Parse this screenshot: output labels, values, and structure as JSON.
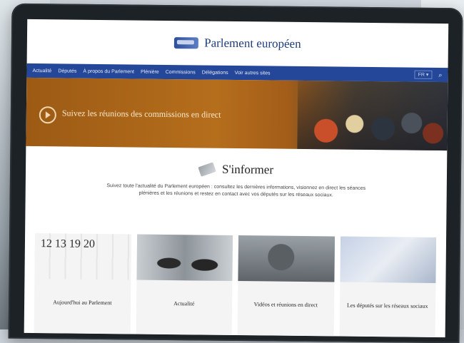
{
  "site": {
    "title": "Parlement européen"
  },
  "nav": {
    "items": [
      "Actualité",
      "Députés",
      "À propos du Parlement",
      "Plénière",
      "Commissions",
      "Délégations",
      "Voir autres sites"
    ],
    "lang": "FR ▾"
  },
  "banner": {
    "text": "Suivez les réunions des commissions en direct"
  },
  "section": {
    "title": "S'informer",
    "text": "Suivez toute l'actualité du Parlement européen : consultez les dernières informations, visionnez en direct les séances plénières et les réunions et restez en contact avec vos députés sur les réseaux sociaux."
  },
  "cards": [
    {
      "label": "Aujourd'hui au Parlement",
      "icon": "calendar-image",
      "numbers": "12 13 19 20"
    },
    {
      "label": "Actualité",
      "icon": "people-image"
    },
    {
      "label": "Vidéos et réunions en direct",
      "icon": "camera-image"
    },
    {
      "label": "Les députés sur les réseaux sociaux",
      "icon": "social-image"
    }
  ],
  "colors": {
    "nav": "#24479a",
    "banner": "#b56e1c",
    "title": "#1f3d7a"
  }
}
